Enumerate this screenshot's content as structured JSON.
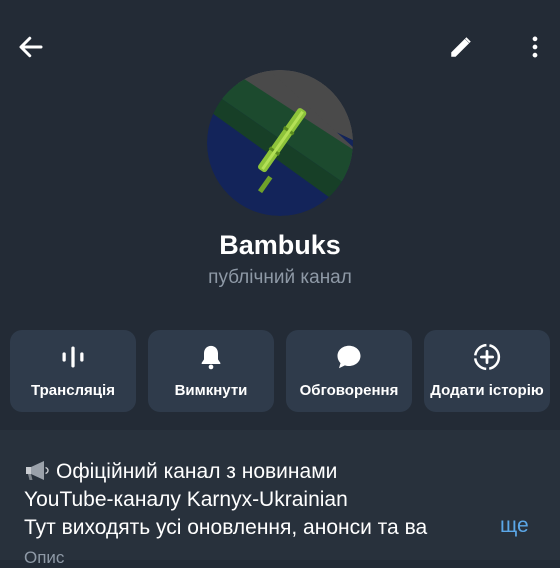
{
  "header": {
    "back_icon": "arrow-left-icon",
    "edit_icon": "pencil-icon",
    "more_icon": "more-vertical-icon"
  },
  "profile": {
    "name": "Bambuks",
    "type": "публічний канал"
  },
  "actions": [
    {
      "label": "Трансляція",
      "icon": "live-stream-icon"
    },
    {
      "label": "Вимкнути",
      "icon": "bell-icon"
    },
    {
      "label": "Обговорення",
      "icon": "chat-bubble-icon"
    },
    {
      "label": "Додати історію",
      "icon": "add-story-icon"
    }
  ],
  "description": {
    "line1": "Офіційний канал з новинами",
    "line2": "YouTube-каналу Karnyx-Ukrainian",
    "line3": "Тут виходять усі оновлення, анонси та ва",
    "more": "ще",
    "label": "Опис"
  },
  "colors": {
    "background": "#232b36",
    "button_bg": "#2f3b4b",
    "secondary_text": "#8e99a6",
    "link": "#5ba7e8"
  }
}
